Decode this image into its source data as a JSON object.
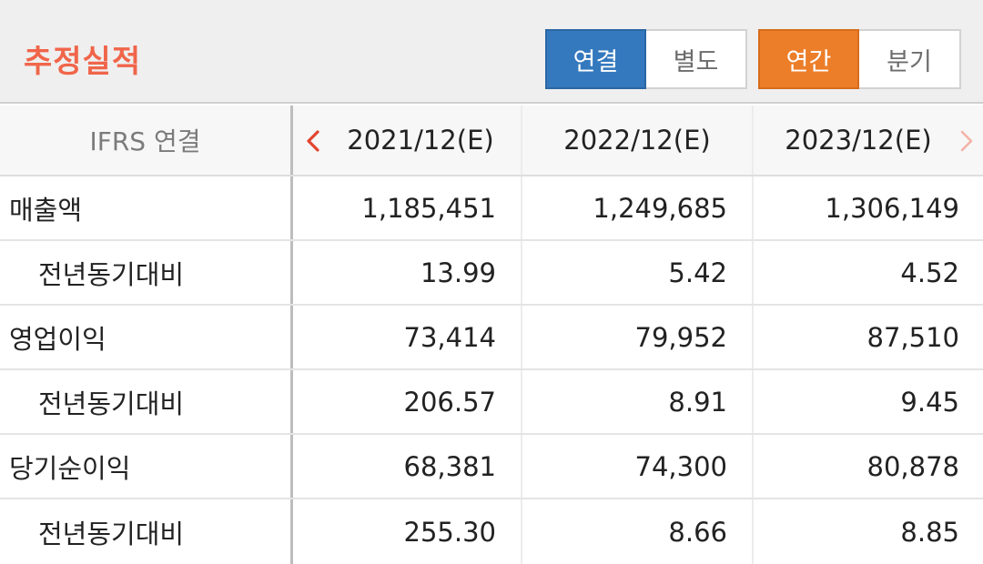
{
  "header": {
    "title": "추정실적",
    "consolidation_toggle": {
      "options": [
        "연결",
        "별도"
      ],
      "selected": "연결"
    },
    "period_toggle": {
      "options": [
        "연간",
        "분기"
      ],
      "selected": "연간"
    },
    "colors": {
      "title": "#f0654a",
      "blue_active": "#3479be",
      "orange_active": "#ec7e2a"
    }
  },
  "table": {
    "standard_label": "IFRS 연결",
    "periods": [
      "2021/12(E)",
      "2022/12(E)",
      "2023/12(E)"
    ],
    "rows": [
      {
        "label": "매출액",
        "values": [
          "1,185,451",
          "1,249,685",
          "1,306,149"
        ]
      },
      {
        "label": "전년동기대비",
        "values": [
          "13.99",
          "5.42",
          "4.52"
        ]
      },
      {
        "label": "영업이익",
        "values": [
          "73,414",
          "79,952",
          "87,510"
        ]
      },
      {
        "label": "전년동기대비",
        "values": [
          "206.57",
          "8.91",
          "9.45"
        ]
      },
      {
        "label": "당기순이익",
        "values": [
          "68,381",
          "74,300",
          "80,878"
        ]
      },
      {
        "label": "전년동기대비",
        "values": [
          "255.30",
          "8.66",
          "8.85"
        ]
      }
    ]
  },
  "icons": {
    "prev": "chevron-left-icon",
    "next": "chevron-right-icon"
  }
}
